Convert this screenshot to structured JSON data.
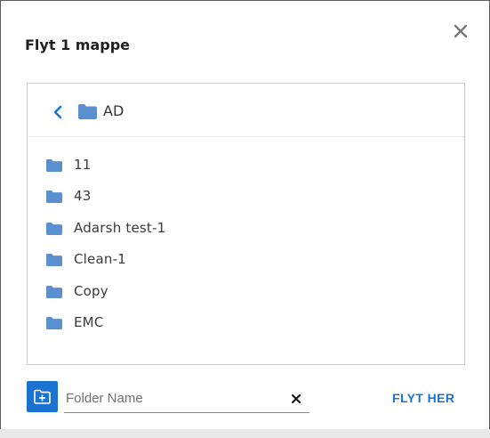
{
  "dialog": {
    "title": "Flyt 1 mappe",
    "close_icon": "close-icon"
  },
  "browser": {
    "current_folder": "AD",
    "back_icon": "chevron-left-icon",
    "folder_icon": "folder-icon",
    "folders": [
      {
        "name": "11"
      },
      {
        "name": "43"
      },
      {
        "name": "Adarsh test-1"
      },
      {
        "name": "Clean-1"
      },
      {
        "name": "Copy"
      },
      {
        "name": "EMC"
      }
    ]
  },
  "footer": {
    "new_folder_icon": "new-folder-icon",
    "folder_name_placeholder": "Folder Name",
    "folder_name_value": "",
    "clear_icon": "close-icon",
    "move_here_label": "FLYT HER"
  },
  "colors": {
    "accent": "#1a73d0",
    "folder": "#5a8fd0",
    "border": "#c9c9c9"
  }
}
